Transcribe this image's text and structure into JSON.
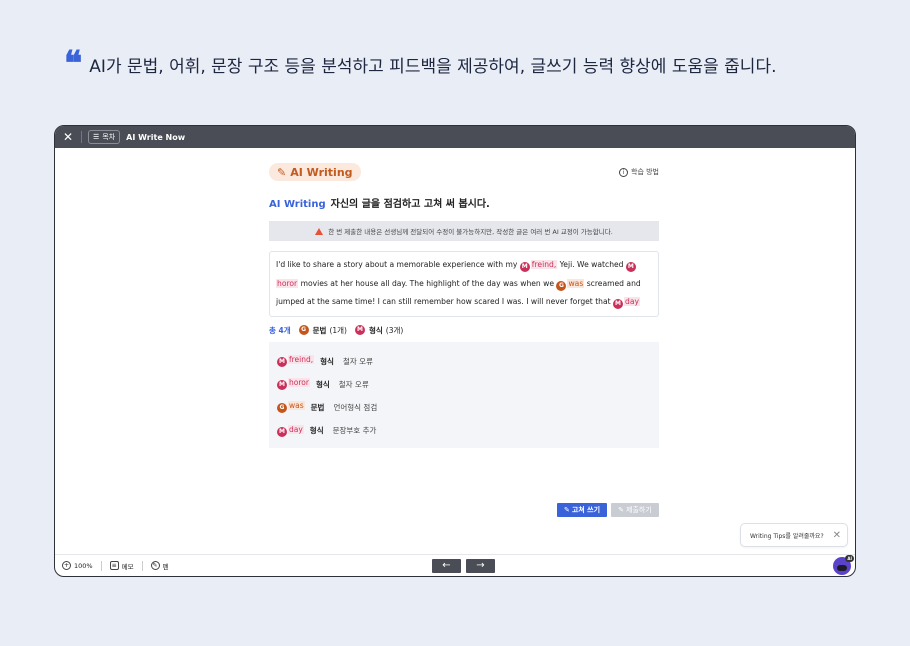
{
  "banner": {
    "quote_mark": "❝",
    "text": "AI가 문법, 어휘, 문장 구조 등을 분석하고 피드백을 제공하여, 글쓰기 능력 향상에 도움을 줍니다."
  },
  "topbar": {
    "toc_label": "목차",
    "title": "AI Write Now"
  },
  "content": {
    "pill_label": "AI Writing",
    "howto_label": "학습 방법",
    "heading_accent": "AI Writing",
    "heading_text": "자신의 글을 점검하고 고쳐 써 봅시다.",
    "warning": "한 번 제출한 내용은 선생님께 전달되어 수정이 불가능하지만, 작성한 글은 여러 번 AI 교정이 가능합니다."
  },
  "essay": {
    "p1": "I'd like to share a story about a memorable experience with my ",
    "w1": "freind,",
    "p2": " Yeji. We watched ",
    "w2": "horor",
    "p3": " movies at her house all day. The highlight of the day was when we ",
    "w3": "was",
    "p4": " screamed and jumped at the same time! I can still remember how scared I was. I will never forget that ",
    "w4": "day"
  },
  "markers": {
    "m": "M",
    "g": "G"
  },
  "summary": {
    "total": "총 4개",
    "grammar_label": "문법",
    "grammar_count": "(1개)",
    "form_label": "형식",
    "form_count": "(3개)"
  },
  "errors": [
    {
      "type": "M",
      "word": "freind,",
      "kind": "형식",
      "desc": "철자 오류"
    },
    {
      "type": "M",
      "word": "horor",
      "kind": "형식",
      "desc": "철자 오류"
    },
    {
      "type": "G",
      "word": "was",
      "kind": "문법",
      "desc": "언어형식 점검"
    },
    {
      "type": "M",
      "word": "day",
      "kind": "형식",
      "desc": "문장부호 추가"
    }
  ],
  "buttons": {
    "fix": "고쳐 쓰기",
    "submit": "제출하기"
  },
  "tips": {
    "text": "Writing Tips를 알려줄까요?"
  },
  "bottombar": {
    "zoom": "100%",
    "memo": "메모",
    "pen": "펜",
    "bot_badge": "AI"
  },
  "colors": {
    "accent": "#3b63d9",
    "form_marker": "#c9305a",
    "grammar_marker": "#c4561c"
  }
}
